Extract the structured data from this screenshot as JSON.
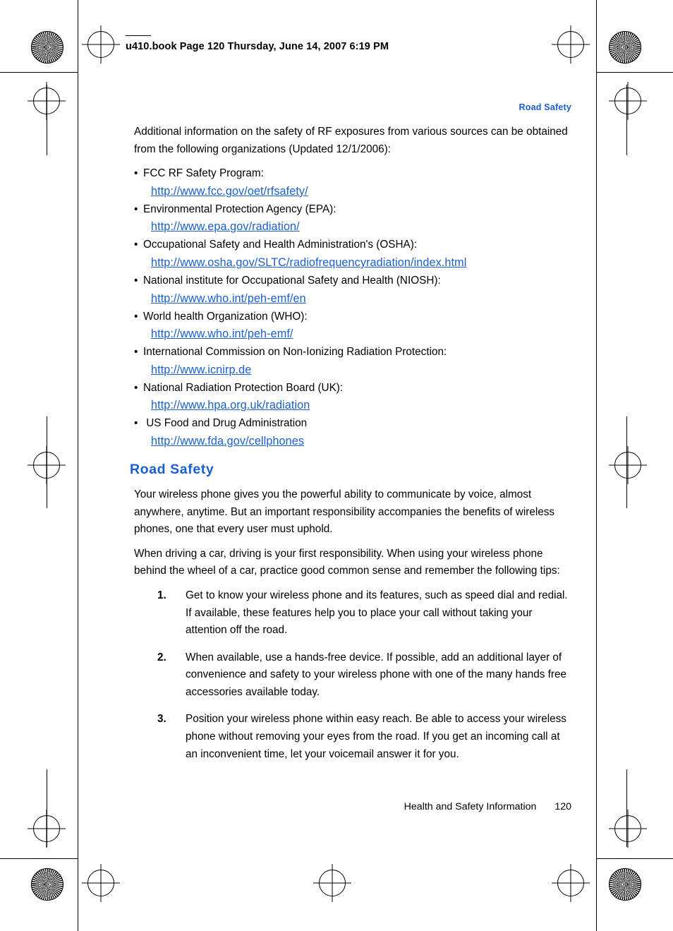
{
  "header": {
    "file_line": "u410.book  Page 120  Thursday, June 14, 2007  6:19 PM"
  },
  "running_head": "Road Safety",
  "intro_paragraph": "Additional information on the safety of RF exposures from various sources can be obtained from the following organizations (Updated 12/1/2006):",
  "organizations": [
    {
      "bullet": "•",
      "label": "FCC RF Safety Program:",
      "url": "http://www.fcc.gov/oet/rfsafety/"
    },
    {
      "bullet": "•",
      "label": "Environmental Protection Agency (EPA):",
      "url": "http://www.epa.gov/radiation/"
    },
    {
      "bullet": "•",
      "label": "Occupational Safety and Health Administration's (OSHA):",
      "url": "http://www.osha.gov/SLTC/radiofrequencyradiation/index.html"
    },
    {
      "bullet": "•",
      "label": "National institute for Occupational Safety and Health (NIOSH):",
      "url": "http://www.who.int/peh-emf/en"
    },
    {
      "bullet": "•",
      "label": "World health Organization (WHO):",
      "url": "http://www.who.int/peh-emf/"
    },
    {
      "bullet": "•",
      "label": "International Commission on Non-Ionizing Radiation Protection:",
      "url": "http://www.icnirp.de"
    },
    {
      "bullet": "•",
      "label": "National Radiation Protection Board (UK):",
      "url": "http://www.hpa.org.uk/radiation"
    },
    {
      "bullet": "•",
      "label": " US Food and Drug Administration",
      "url": "http://www.fda.gov/cellphones"
    }
  ],
  "section": {
    "title": "Road Safety",
    "paragraph_1": "Your wireless phone gives you the powerful ability to communicate by voice, almost anywhere, anytime. But an important responsibility accompanies the benefits of wireless phones, one that every user must uphold.",
    "paragraph_2": "When driving a car, driving is your first responsibility. When using your wireless phone behind the wheel of a car, practice good common sense and remember the following tips:",
    "tips": [
      {
        "num": "1.",
        "text": "Get to know your wireless phone and its features, such as speed dial and redial. If available, these features help you to place your call without taking your attention off the road."
      },
      {
        "num": "2.",
        "text": "When available, use a hands-free device. If possible, add an additional layer of convenience and safety to your wireless phone with one of the many hands free accessories available today."
      },
      {
        "num": "3.",
        "text": "Position your wireless phone within easy reach. Be able to access your wireless phone without removing your eyes from the road. If you get an incoming call at an inconvenient time, let your voicemail answer it for you."
      }
    ]
  },
  "footer": {
    "label": "Health and Safety Information",
    "page_number": "120"
  },
  "colors": {
    "link": "#1a5fd0",
    "heading": "#1a5fd0",
    "text": "#000000"
  }
}
